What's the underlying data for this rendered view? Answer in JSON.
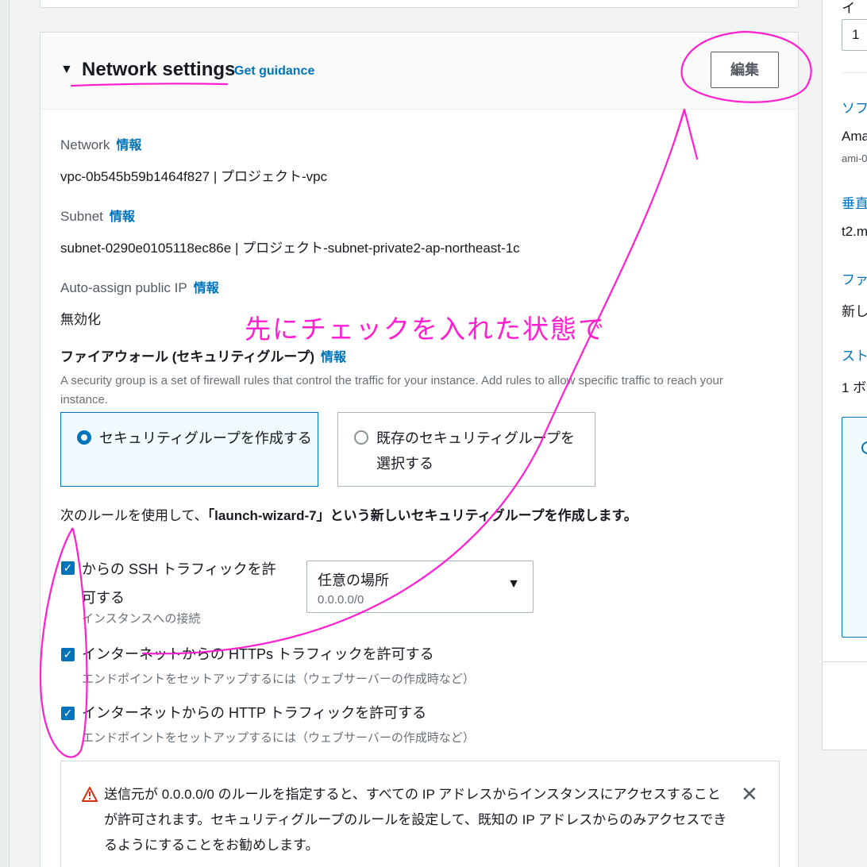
{
  "header": {
    "title": "Network settings",
    "guidance": "Get guidance",
    "edit": "編集"
  },
  "network": {
    "label": "Network",
    "info": "情報",
    "value": "vpc-0b545b59b1464f827 | プロジェクト-vpc"
  },
  "subnet": {
    "label": "Subnet",
    "info": "情報",
    "value": "subnet-0290e0105118ec86e | プロジェクト-subnet-private2-ap-northeast-1c"
  },
  "public_ip": {
    "label": "Auto-assign public IP",
    "info": "情報",
    "value": "無効化"
  },
  "firewall": {
    "title": "ファイアウォール (セキュリティグループ)",
    "info": "情報",
    "description": "A security group is a set of firewall rules that control the traffic for your instance. Add rules to allow specific traffic to reach your instance.",
    "option_create": "セキュリティグループを作成する",
    "option_existing": "既存のセキュリティグループを選択する",
    "rule_prefix": "次のルールを使用して、",
    "rule_bold": "「launch-wizard-7」という新しいセキュリティグループを作成します。"
  },
  "rules": {
    "ssh_label": "からの SSH トラフィックを許可する",
    "ssh_sub": "インスタンスへの接続",
    "ssh_source": "任意の場所",
    "ssh_cidr": "0.0.0.0/0",
    "https_label": "インターネットからの HTTPs トラフィックを許可する",
    "https_sub": "エンドポイントをセットアップするには（ウェブサーバーの作成時など）",
    "http_label": "インターネットからの HTTP トラフィックを許可する",
    "http_sub": "エンドポイントをセットアップするには（ウェブサーバーの作成時など）"
  },
  "alert": {
    "text": "送信元が 0.0.0.0/0 のルールを指定すると、すべての IP アドレスからインスタンスにアクセスすることが許可されます。セキュリティグループのルールを設定して、既知の IP アドレスからのみアクセスできるようにすることをお勧めします。",
    "close": "✕"
  },
  "side": {
    "t1": "イ",
    "input": "1",
    "t2": "ソフ",
    "t3": "Ama",
    "t4": "ami-0",
    "t5": "垂直",
    "t6": "t2.m",
    "t7": "ファ",
    "t8": "新し",
    "t9": "スト",
    "t10": "1 ボ"
  },
  "annotation": {
    "text": "先にチェックを入れた状態で",
    "color": "#ff1fd0"
  },
  "icons": {
    "caret": "caret-down-icon",
    "warning": "warning-icon",
    "close": "close-icon",
    "dropdown": "dropdown-arrow-icon"
  }
}
